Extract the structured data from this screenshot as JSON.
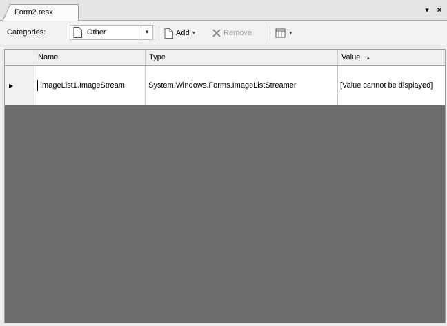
{
  "tab": {
    "title": "Form2.resx"
  },
  "pane_controls": {
    "dropdown_glyph": "▾",
    "close_glyph": "×"
  },
  "toolbar": {
    "categories_label": "Categories:",
    "category_value": "Other",
    "category_arrow": "▼",
    "add_label": "Add",
    "remove_label": "Remove",
    "views_arrow": "▼"
  },
  "grid": {
    "columns": [
      "Name",
      "Type",
      "Value"
    ],
    "sort_glyph": "▲",
    "rows": [
      {
        "indicator": "▶",
        "name": "ImageList1.ImageStream",
        "type": "System.Windows.Forms.ImageListStreamer",
        "value": "[Value cannot be displayed]"
      }
    ]
  },
  "colors": {
    "empty_area": "#6b6b6b",
    "header_bg": "#f0f0f0",
    "row_bg": "#ffffff"
  }
}
